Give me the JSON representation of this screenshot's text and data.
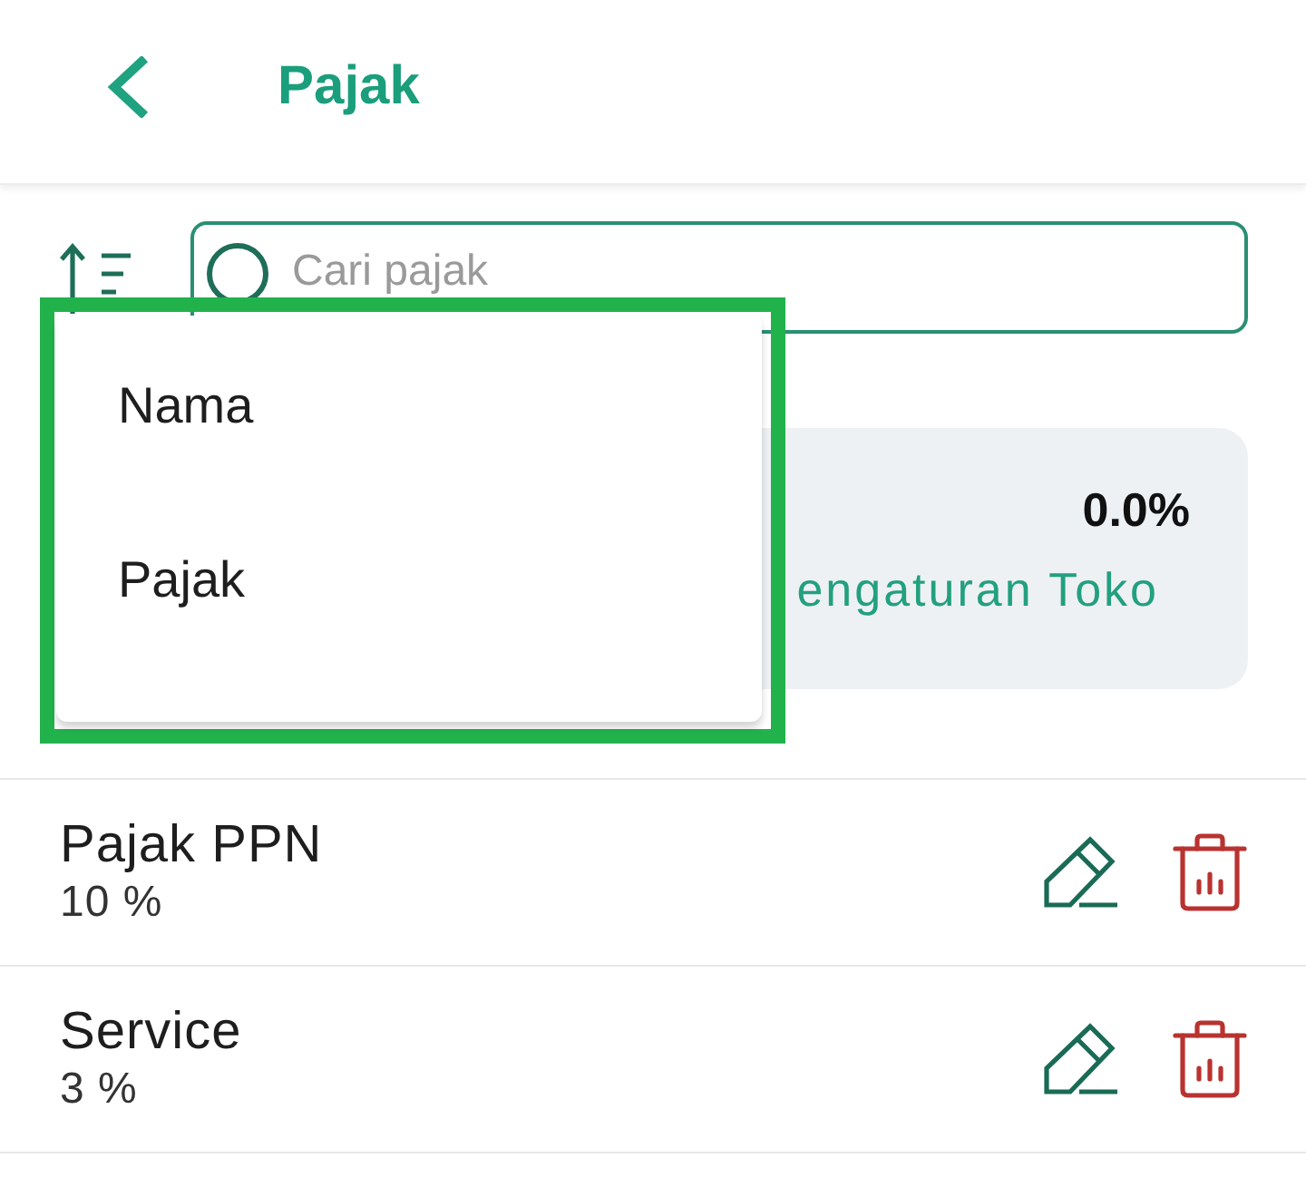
{
  "header": {
    "title": "Pajak"
  },
  "search": {
    "placeholder": "Cari pajak"
  },
  "summary_card": {
    "value": "0.0%",
    "link": "engaturan Toko"
  },
  "taxes": [
    {
      "name": "Pajak PPN",
      "rate": "10 %"
    },
    {
      "name": "Service",
      "rate": "3 %"
    }
  ],
  "sort_menu": {
    "highlighted": true,
    "items": [
      {
        "label": "Nama"
      },
      {
        "label": "Pajak"
      }
    ]
  }
}
